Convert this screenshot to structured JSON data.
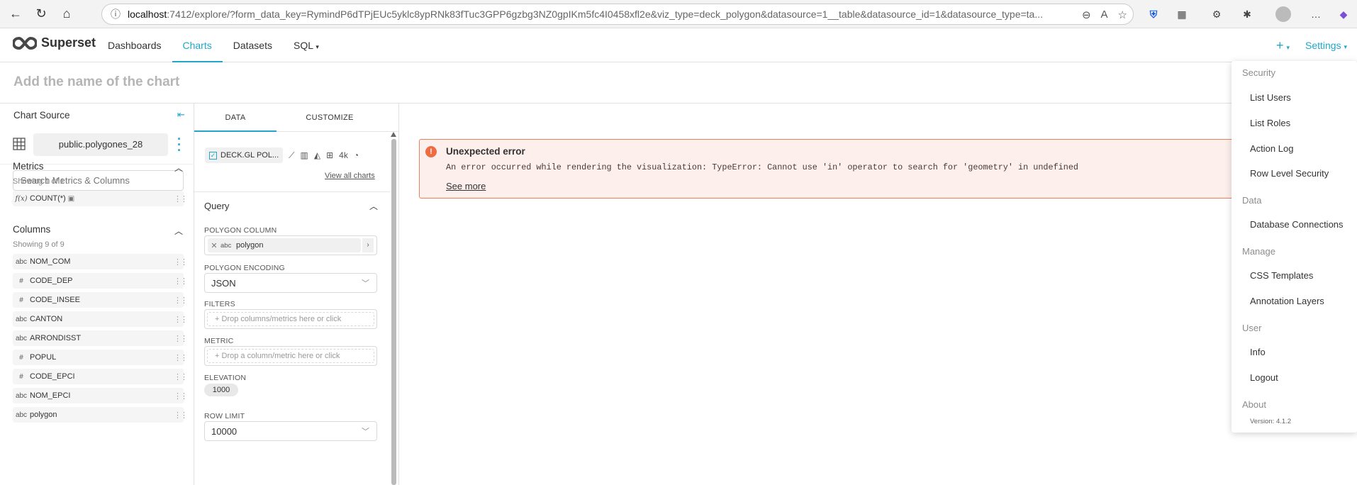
{
  "browser": {
    "url_host": "localhost",
    "url_path": ":7412/explore/?form_data_key=RymindP6dTPjEUc5yklc8ypRNk83fTuc3GPP6gzbg3NZ0gpIKm5fc4I0458xfl2e&viz_type=deck_polygon&datasource=1__table&datasource_id=1&datasource_type=ta..."
  },
  "header": {
    "logo_text": "Superset",
    "nav": [
      "Dashboards",
      "Charts",
      "Datasets",
      "SQL"
    ],
    "plus_label": "+",
    "settings_label": "Settings"
  },
  "chart_title_placeholder": "Add the name of the chart",
  "left_panel": {
    "title": "Chart Source",
    "dataset": "public.polygones_28",
    "search_placeholder": "Search Metrics & Columns",
    "metrics_title": "Metrics",
    "metrics_showing": "Showing 1 of 1",
    "metrics": [
      {
        "type": "f(x)",
        "name": "COUNT(*)"
      }
    ],
    "columns_title": "Columns",
    "columns_showing": "Showing 9 of 9",
    "columns": [
      {
        "type": "abc",
        "name": "NOM_COM"
      },
      {
        "type": "#",
        "name": "CODE_DEP"
      },
      {
        "type": "#",
        "name": "CODE_INSEE"
      },
      {
        "type": "abc",
        "name": "CANTON"
      },
      {
        "type": "abc",
        "name": "ARRONDISST"
      },
      {
        "type": "#",
        "name": "POPUL"
      },
      {
        "type": "#",
        "name": "CODE_EPCI"
      },
      {
        "type": "abc",
        "name": "NOM_EPCI"
      },
      {
        "type": "abc",
        "name": "polygon"
      }
    ]
  },
  "control_panel": {
    "tab_data": "DATA",
    "tab_customize": "CUSTOMIZE",
    "viz_name": "DECK.GL POL...",
    "viz_4k": "4k",
    "view_all": "View all charts",
    "query_title": "Query",
    "polygon_column_label": "POLYGON COLUMN",
    "polygon_column_type": "abc",
    "polygon_column_value": "polygon",
    "polygon_encoding_label": "POLYGON ENCODING",
    "polygon_encoding_value": "JSON",
    "filters_label": "FILTERS",
    "filters_hint": "Drop columns/metrics here or click",
    "metric_label": "METRIC",
    "metric_hint": "Drop a column/metric here or click",
    "elevation_label": "ELEVATION",
    "elevation_value": "1000",
    "row_limit_label": "ROW LIMIT",
    "row_limit_value": "10000"
  },
  "error": {
    "title": "Unexpected error",
    "message": "An error occurred while rendering the visualization: TypeError: Cannot use 'in' operator to search for 'geometry' in undefined",
    "see_more": "See more"
  },
  "settings_menu": {
    "groups": [
      {
        "title": "Security",
        "items": [
          "List Users",
          "List Roles",
          "Action Log",
          "Row Level Security"
        ]
      },
      {
        "title": "Data",
        "items": [
          "Database Connections"
        ]
      },
      {
        "title": "Manage",
        "items": [
          "CSS Templates",
          "Annotation Layers"
        ]
      },
      {
        "title": "User",
        "items": [
          "Info",
          "Logout"
        ]
      },
      {
        "title": "About",
        "items": []
      }
    ],
    "version": "Version: 4.1.2"
  },
  "colors": {
    "accent": "#20a7c9",
    "error_border": "#e7825f",
    "error_bg": "#fcefec"
  }
}
